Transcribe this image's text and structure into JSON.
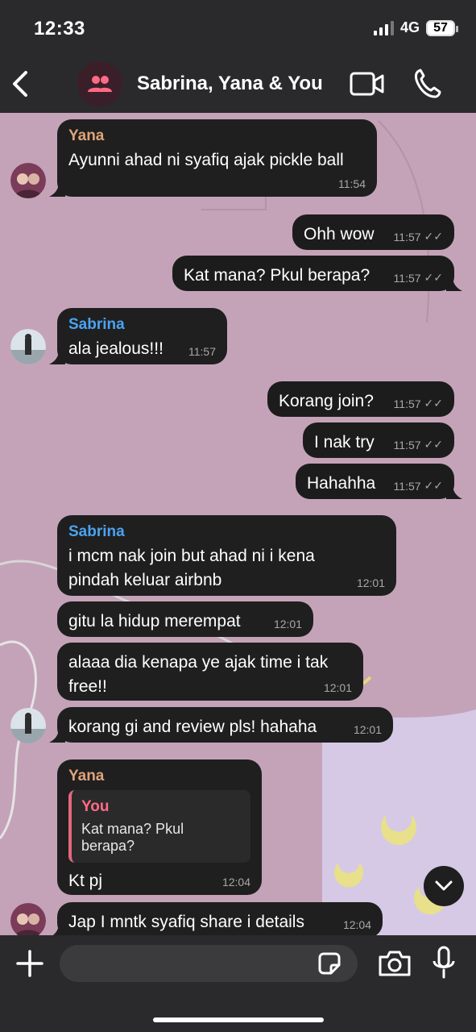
{
  "status_bar": {
    "time": "12:33",
    "network": "4G",
    "battery": "57"
  },
  "header": {
    "title": "Sabrina, Yana & You"
  },
  "messages": [
    {
      "sender": "Yana",
      "text": "Ayunni ahad ni syafiq ajak pickle ball",
      "time": "11:54"
    },
    {
      "text": "Ohh wow",
      "time": "11:57"
    },
    {
      "text": "Kat mana? Pkul berapa?",
      "time": "11:57"
    },
    {
      "sender": "Sabrina",
      "text": "ala jealous!!!",
      "time": "11:57"
    },
    {
      "text": "Korang join?",
      "time": "11:57"
    },
    {
      "text": "I nak try",
      "time": "11:57"
    },
    {
      "text": "Hahahha",
      "time": "11:57"
    },
    {
      "sender": "Sabrina",
      "text_line1": "i mcm nak join but ahad ni i kena",
      "text_line2": "pindah keluar airbnb",
      "time": "12:01"
    },
    {
      "text": "gitu la hidup merempat",
      "time": "12:01"
    },
    {
      "text_line1": "alaaa dia kenapa ye ajak time i tak",
      "text_line2": "free!!",
      "time": "12:01"
    },
    {
      "text": "korang gi and review pls! hahaha",
      "time": "12:01"
    },
    {
      "sender": "Yana",
      "reply_name": "You",
      "reply_text": "Kat mana? Pkul berapa?",
      "text": "Kt pj",
      "time": "12:04"
    },
    {
      "text": "Jap I mntk syafiq share i details",
      "time": "12:04"
    }
  ],
  "colors": {
    "yana": "#e0a37a",
    "sabrina": "#4aa3f0",
    "reply_accent": "#e5677f",
    "chat_background": "#c4a3b8"
  },
  "icons": {
    "back": "chevron-left-icon",
    "group": "group-icon",
    "video": "video-camera-icon",
    "call": "phone-icon",
    "scroll": "chevron-down-icon",
    "attach": "plus-icon",
    "sticker": "sticker-icon",
    "camera": "camera-icon",
    "mic": "microphone-icon"
  },
  "composer": {
    "placeholder": ""
  }
}
